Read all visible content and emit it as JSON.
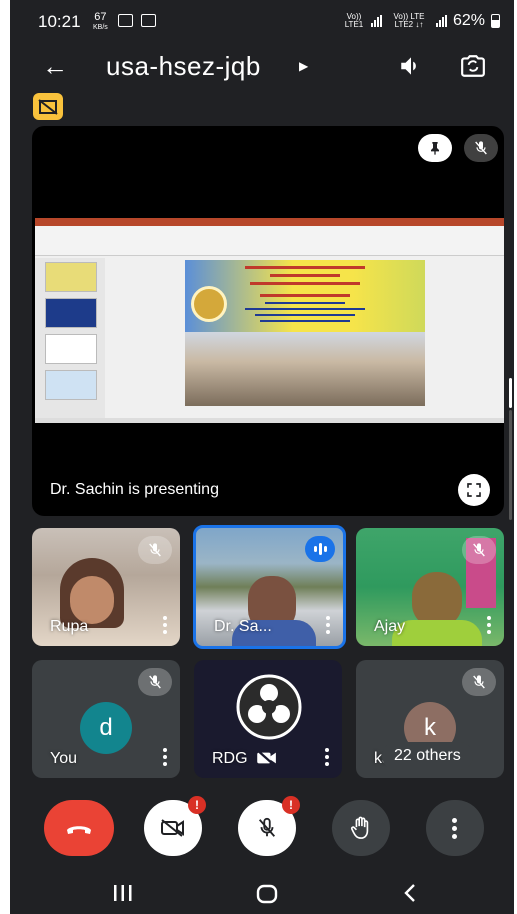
{
  "status_bar": {
    "time": "10:21",
    "speed_value": "67",
    "speed_unit": "KB/s",
    "net1": "Vo)) LTE1",
    "net2": "Vo)) LTE LTE2 ↓↑",
    "battery": "62%"
  },
  "header": {
    "back_icon": "arrow-back-icon",
    "meeting_code": "usa-hsez-jqb",
    "caret_icon": "caret-right-icon",
    "speaker_icon": "speaker-icon",
    "switch_camera_icon": "switch-camera-icon"
  },
  "presentation": {
    "presenter_text": "Dr. Sachin is presenting",
    "pin_icon": "pin-icon",
    "mute_icon": "mic-off-icon",
    "fullscreen_icon": "fullscreen-icon"
  },
  "participants": [
    {
      "name": "Rupa",
      "muted": true,
      "type": "video"
    },
    {
      "name": "Dr. Sa...",
      "muted": false,
      "speaking": true,
      "type": "video"
    },
    {
      "name": "Ajay",
      "muted": true,
      "type": "video"
    },
    {
      "name": "You",
      "muted": true,
      "type": "avatar",
      "initial": "d",
      "avatar_color": "#12858e"
    },
    {
      "name": "RDG",
      "muted": false,
      "video_off": true,
      "type": "obs"
    },
    {
      "name": "ka",
      "muted": true,
      "type": "avatar",
      "initial": "k",
      "avatar_color": "#8d6e63",
      "others_label": "22 others"
    }
  ],
  "controls": {
    "end_call": "end-call-icon",
    "camera": "camera-off-icon",
    "mic": "mic-off-icon",
    "hand": "raise-hand-icon",
    "more": "more-icon",
    "alert_mark": "!"
  },
  "colors": {
    "background": "#202124",
    "end_call_red": "#ea4335",
    "alert_red": "#d93025",
    "speaking_blue": "#1a73e8",
    "badge_yellow": "#f9c23c"
  }
}
